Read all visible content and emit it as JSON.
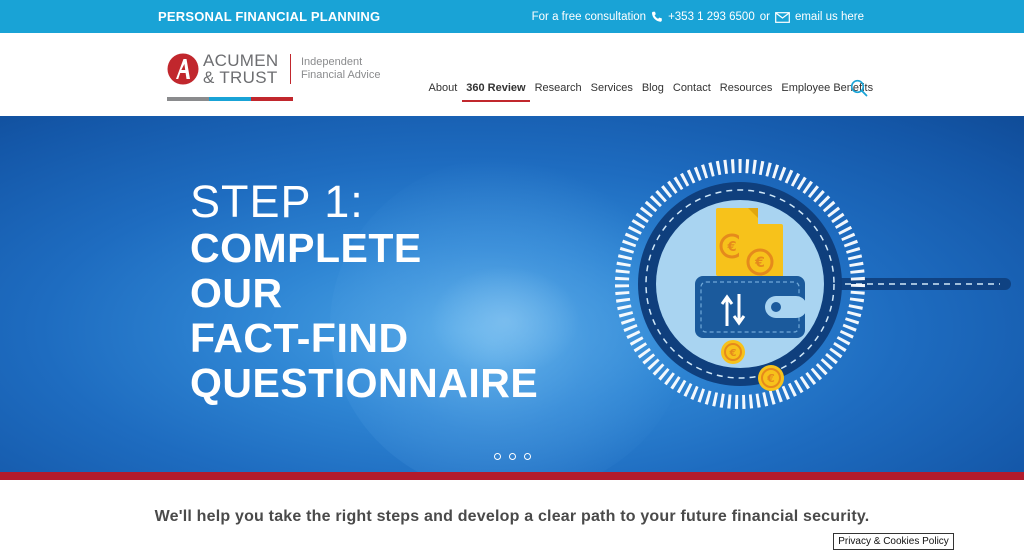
{
  "topbar": {
    "tagline": "PERSONAL FINANCIAL PLANNING",
    "consultation_text": "For a free consultation",
    "phone": "+353 1 293 6500",
    "or_text": "or",
    "email_text": "email us here"
  },
  "logo": {
    "brand_line1": "ACUMEN",
    "brand_line2": "& TRUST",
    "tagline_line1": "Independent",
    "tagline_line2": "Financial Advice"
  },
  "nav": {
    "items": [
      {
        "label": "About"
      },
      {
        "label": "360 Review"
      },
      {
        "label": "Research"
      },
      {
        "label": "Services"
      },
      {
        "label": "Blog"
      },
      {
        "label": "Contact"
      },
      {
        "label": "Resources"
      },
      {
        "label": "Employee Benefits"
      }
    ],
    "active": "360 Review"
  },
  "hero": {
    "step": "STEP 1:",
    "headline": [
      "COMPLETE",
      "OUR",
      "FACT-FIND",
      "QUESTIONNAIRE"
    ],
    "slides": 3
  },
  "main": {
    "tagline": "We'll help you take the right steps and develop a clear path to your future financial security."
  },
  "footer": {
    "privacy_label": "Privacy & Cookies Policy"
  },
  "colors": {
    "topbar": "#19a3d6",
    "accent_red": "#c1272d",
    "hero_blue": "#1e6cc0"
  }
}
